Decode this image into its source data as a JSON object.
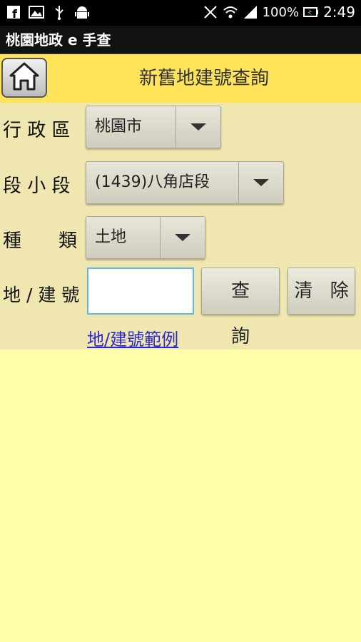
{
  "status_bar": {
    "left_icons": [
      "facebook-icon",
      "image-icon",
      "usb-icon",
      "android-icon"
    ],
    "right_icons": [
      "vibrate-icon",
      "wifi-icon",
      "signal-icon"
    ],
    "battery_text": "100%",
    "battery_icon": "battery-charging-icon",
    "time": "2:49"
  },
  "app": {
    "title": "桃園地政 e 手查"
  },
  "header": {
    "title": "新舊地建號查詢",
    "home_icon": "home-icon"
  },
  "form": {
    "district": {
      "label": "行 政 區",
      "value": "桃園市"
    },
    "section": {
      "label": "段 小 段",
      "value": "(1439)八角店段"
    },
    "type": {
      "label": "種　　類",
      "value": "土地"
    },
    "number": {
      "label": "地 / 建 號",
      "value": "",
      "placeholder": ""
    },
    "search_button": "查 詢",
    "clear_button": "清 除",
    "example_link": "地/建號範例"
  },
  "colors": {
    "background": "#fffdaa",
    "header": "#ffe45a",
    "panel": "#efe7af",
    "link": "#2a2acc",
    "input_border": "#5fb7e8"
  }
}
